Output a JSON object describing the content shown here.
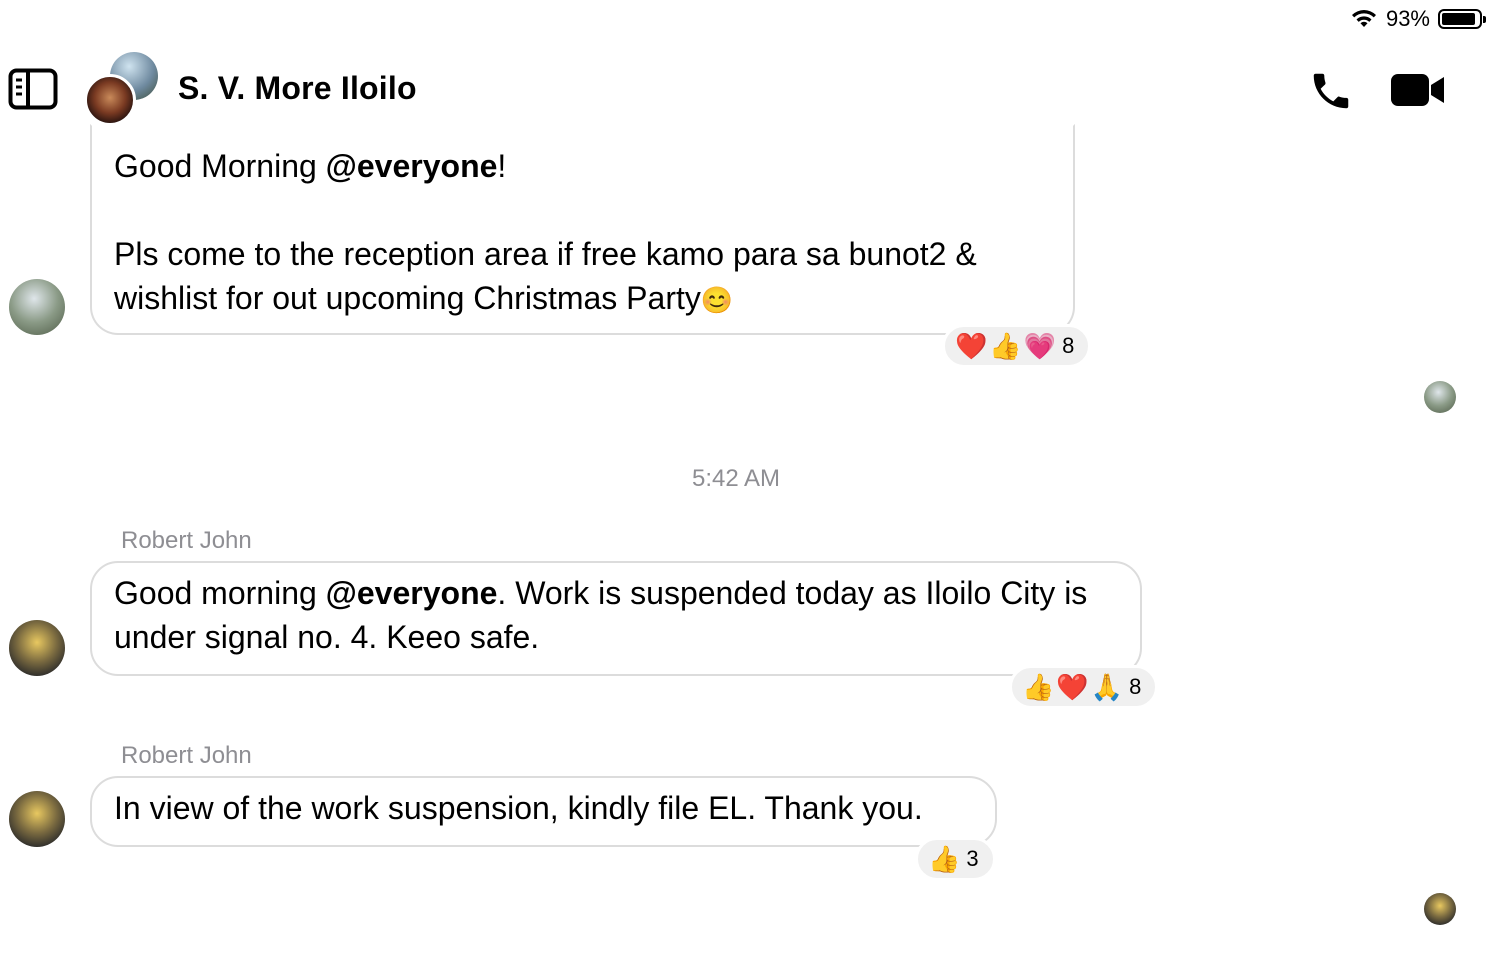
{
  "status_bar": {
    "battery_text": "93%",
    "battery_level": 0.93
  },
  "header": {
    "title": "S. V. More Iloilo",
    "icons": [
      "sidebar-toggle-icon",
      "phone-icon",
      "video-camera-icon"
    ]
  },
  "messages": [
    {
      "line1_pre": "Good Morning ",
      "mention": "@everyone",
      "line1_post": "!",
      "body": "Pls come to the reception area  if free kamo para sa bunot2 & wishlist for out upcoming Christmas Party",
      "emoji": "😊",
      "reactions": [
        "❤️",
        "👍",
        "💗"
      ],
      "reaction_count": "8"
    },
    {
      "sender": "Robert John",
      "pre": "Good morning ",
      "mention": "@everyone",
      "post": ". Work is suspended today as Iloilo City is under signal no. 4. Keeo safe.",
      "reactions": [
        "👍",
        "❤️",
        "🙏"
      ],
      "reaction_count": "8"
    },
    {
      "sender": "Robert John",
      "text": "In view of the work suspension, kindly file EL. Thank you.",
      "reactions": [
        "👍"
      ],
      "reaction_count": "3"
    }
  ],
  "timestamp": "5:42 AM",
  "colors": {
    "bubble_border": "#dcdcdc",
    "secondary_text": "#8e8e93",
    "reaction_bg": "#f0f0f0"
  }
}
